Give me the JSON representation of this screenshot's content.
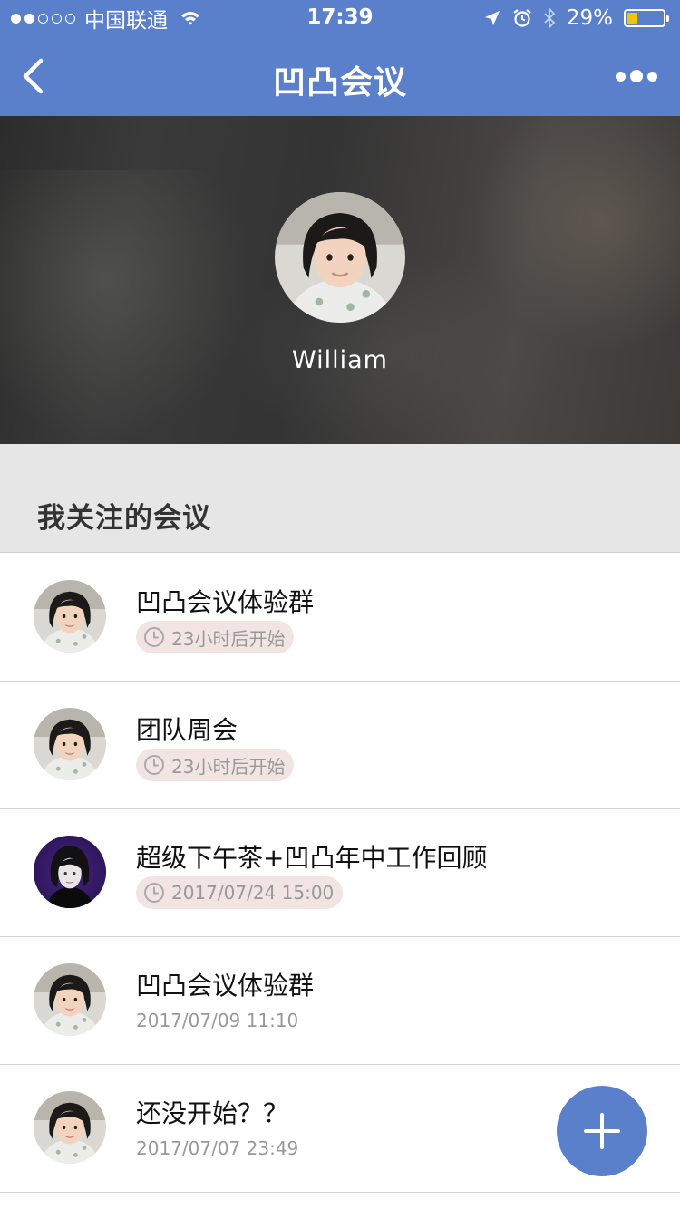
{
  "status_bar": {
    "carrier": "中国联通",
    "time": "17:39",
    "battery": "29%",
    "battery_level": 0.29
  },
  "nav": {
    "title": "凹凸会议",
    "back_icon": "chevron-left-icon",
    "more_icon": "more-dots-icon"
  },
  "profile": {
    "name": "William"
  },
  "section": {
    "title": "我关注的会议"
  },
  "meetings": [
    {
      "title": "凹凸会议体验群",
      "time": "23小时后开始",
      "style": "pill",
      "avatar": "girl"
    },
    {
      "title": "团队周会",
      "time": "23小时后开始",
      "style": "pill",
      "avatar": "girl"
    },
    {
      "title": "超级下午茶+凹凸年中工作回顾",
      "time": "2017/07/24 15:00",
      "style": "pill",
      "avatar": "boy"
    },
    {
      "title": "凹凸会议体验群",
      "time": "2017/07/09 11:10",
      "style": "plain",
      "avatar": "girl"
    },
    {
      "title": "还没开始？？",
      "time": "2017/07/07 23:49",
      "style": "plain",
      "avatar": "girl"
    }
  ],
  "fab": {
    "icon": "plus-icon"
  },
  "colors": {
    "primary": "#5a80cc",
    "pill_bg": "#f3e4e4",
    "muted_text": "#999999",
    "section_bg": "#e6e6e6",
    "battery_fill": "#f5c400"
  }
}
